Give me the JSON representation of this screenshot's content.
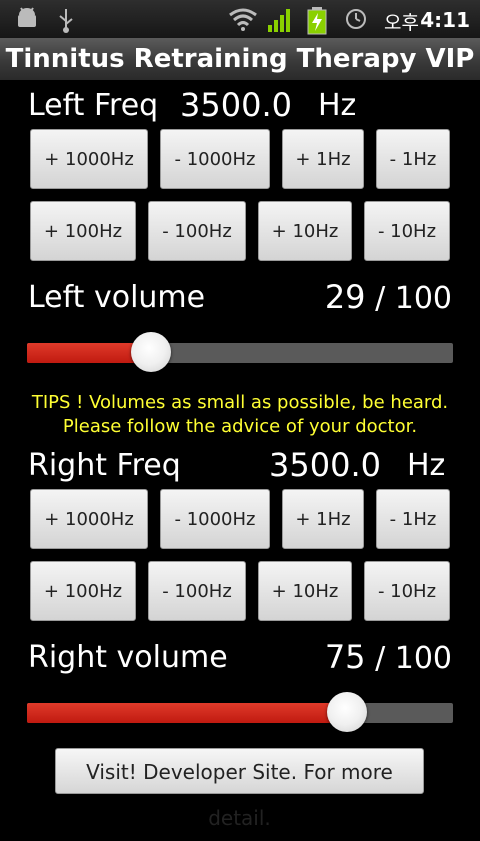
{
  "status_bar": {
    "time": "4:11",
    "lang": "오후",
    "icons": [
      "android-debug-icon",
      "usb-icon",
      "wifi-icon",
      "signal-icon",
      "battery-charging-icon",
      "alarm-icon"
    ]
  },
  "app": {
    "title": "Tinnitus Retraining Therapy VIP"
  },
  "left": {
    "freq_label": "Left Freq",
    "freq_value": "3500.0",
    "freq_unit": "Hz",
    "buttons_row1": [
      "+ 1000Hz",
      "- 1000Hz",
      "+ 1Hz",
      "- 1Hz"
    ],
    "buttons_row2": [
      "+ 100Hz",
      "- 100Hz",
      "+ 10Hz",
      "- 10Hz"
    ],
    "volume_label": "Left volume",
    "volume_value": "29",
    "volume_sep": "/",
    "volume_max": "100",
    "volume_fraction": 0.29
  },
  "tips": {
    "line1": "TIPS ! Volumes as small as possible, be heard.",
    "line2": "Please follow the advice of your doctor."
  },
  "right": {
    "freq_label": "Right Freq",
    "freq_value": "3500.0",
    "freq_unit": "Hz",
    "buttons_row1": [
      "+ 1000Hz",
      "- 1000Hz",
      "+ 1Hz",
      "- 1Hz"
    ],
    "buttons_row2": [
      "+ 100Hz",
      "- 100Hz",
      "+ 10Hz",
      "- 10Hz"
    ],
    "volume_label": "Right volume",
    "volume_value": "75",
    "volume_sep": "/",
    "volume_max": "100",
    "volume_fraction": 0.75
  },
  "developer_button": "Visit! Developer Site. For more detail.",
  "colors": {
    "slider_fill": "#d42a1c",
    "tips_text": "#ffff33"
  }
}
